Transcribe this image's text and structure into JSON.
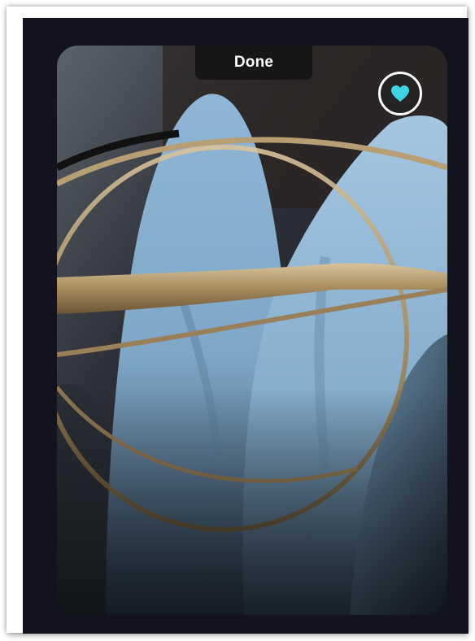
{
  "viewer": {
    "done_label": "Done",
    "favorite_icon": "heart-icon",
    "favorite_color": "#3fd3e6",
    "background_color": "#13131f"
  },
  "photo": {
    "subject": "eyeglasses-on-folded-cloth"
  }
}
